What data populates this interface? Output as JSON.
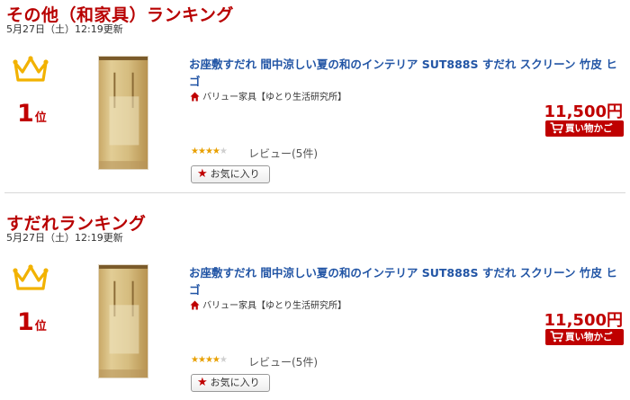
{
  "rankings": [
    {
      "title": "その他（和家具）ランキング",
      "updated": "5月27日（土）12:19更新",
      "rank_number": "1",
      "rank_suffix": "位",
      "product": {
        "name": "お座敷すだれ 間中涼しい夏の和のインテリア SUT888S すだれ スクリーン 竹皮 ヒゴ",
        "shop": "バリュー家具【ゆとり生活研究所】",
        "price": "11,500円",
        "cart_label": "買い物かご",
        "review_text": "レビュー(5件)",
        "rating": 4,
        "favorite_label": "お気に入り"
      }
    },
    {
      "title": "すだれランキング",
      "updated": "5月27日（土）12:19更新",
      "rank_number": "1",
      "rank_suffix": "位",
      "product": {
        "name": "お座敷すだれ 間中涼しい夏の和のインテリア SUT888S すだれ スクリーン 竹皮 ヒゴ",
        "shop": "バリュー家具【ゆとり生活研究所】",
        "price": "11,500円",
        "cart_label": "買い物かご",
        "review_text": "レビュー(5件)",
        "rating": 4,
        "favorite_label": "お気に入り"
      }
    }
  ],
  "icons": {
    "crown": "crown-icon",
    "shop": "home-icon",
    "cart": "cart-icon",
    "favorite": "star-icon"
  },
  "colors": {
    "accent_red": "#b80000",
    "link_blue": "#2255a5",
    "crown_gold": "#f2b200",
    "star_on": "#e8a000"
  }
}
